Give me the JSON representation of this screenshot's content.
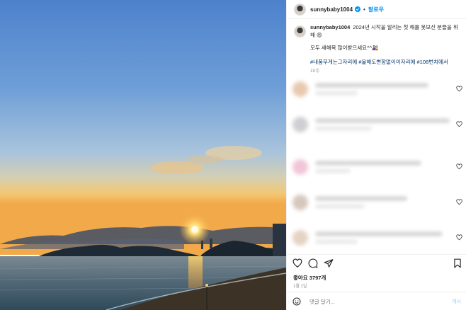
{
  "post": {
    "username": "sunnybaby1004",
    "separator": "•",
    "follow_label": "팔로우",
    "caption_text": "2024년 시작을 알리는 첫 해를 못보신 분들을 위해 😍",
    "caption_line2": "모두 새해복 많이받으세요^^🎎",
    "hashtags": "#내품무게는그자리에 #올해도변함없이이자리에 #108번치에서",
    "caption_time": "10주",
    "likes": "좋아요 3797개",
    "date": "1월 1일",
    "comment_placeholder": "댓글 달기...",
    "post_label": "게시"
  },
  "icons": {
    "verified": "verified-badge-icon",
    "heart": "heart-icon",
    "like": "like-icon",
    "comment": "comment-icon",
    "share": "share-icon",
    "save": "bookmark-icon",
    "emoji": "emoji-icon"
  },
  "colors": {
    "accent": "#0095f6",
    "hashtag": "#00376b",
    "muted": "#8e8e8e"
  }
}
